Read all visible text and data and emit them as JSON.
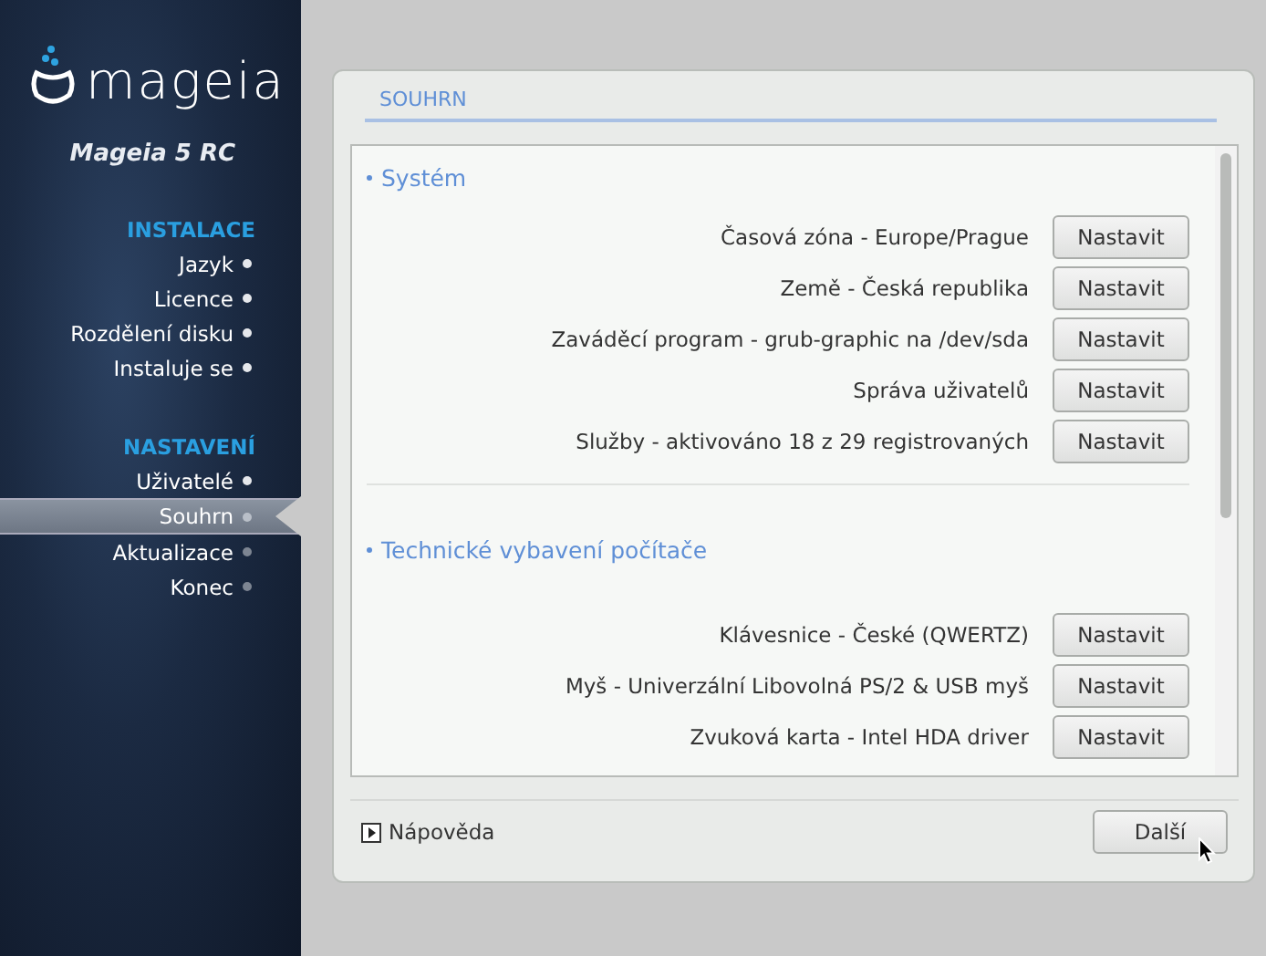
{
  "sidebar": {
    "logo_text": "mageia",
    "product": "Mageia 5 RC",
    "sections": [
      {
        "title": "INSTALACE",
        "items": [
          {
            "label": "Jazyk",
            "selected": false,
            "done": true
          },
          {
            "label": "Licence",
            "selected": false,
            "done": true
          },
          {
            "label": "Rozdělení disku",
            "selected": false,
            "done": true
          },
          {
            "label": "Instaluje se",
            "selected": false,
            "done": true
          }
        ]
      },
      {
        "title": "NASTAVENÍ",
        "items": [
          {
            "label": "Uživatelé",
            "selected": false,
            "done": true
          },
          {
            "label": "Souhrn",
            "selected": true,
            "done": false
          },
          {
            "label": "Aktualizace",
            "selected": false,
            "done": false
          },
          {
            "label": "Konec",
            "selected": false,
            "done": false
          }
        ]
      }
    ]
  },
  "panel": {
    "title": "SOUHRN",
    "groups": [
      {
        "title": "Systém",
        "rows": [
          {
            "label": "Časová zóna - Europe/Prague",
            "button": "Nastavit"
          },
          {
            "label": "Země - Česká republika",
            "button": "Nastavit"
          },
          {
            "label": "Zaváděcí program - grub-graphic na /dev/sda",
            "button": "Nastavit"
          },
          {
            "label": "Správa uživatelů",
            "button": "Nastavit"
          },
          {
            "label": "Služby - aktivováno 18 z 29 registrovaných",
            "button": "Nastavit"
          }
        ]
      },
      {
        "title": "Technické vybavení počítače",
        "rows": [
          {
            "label": "Klávesnice - České (QWERTZ)",
            "button": "Nastavit"
          },
          {
            "label": "Myš - Univerzální Libovolná PS/2 & USB myš",
            "button": "Nastavit"
          },
          {
            "label": "Zvuková karta - Intel HDA driver",
            "button": "Nastavit"
          }
        ]
      }
    ],
    "help": "Nápověda",
    "next": "Další"
  }
}
